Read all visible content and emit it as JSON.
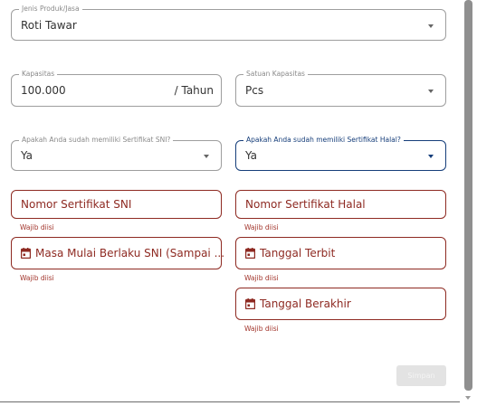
{
  "form": {
    "jenis": {
      "legend": "Jenis Produk/Jasa",
      "value": "Roti Tawar"
    },
    "kapasitas": {
      "legend": "Kapasitas",
      "value": "100.000",
      "suffix": "/ Tahun"
    },
    "satuan": {
      "legend": "Satuan Kapasitas",
      "value": "Pcs"
    },
    "sni_question": {
      "legend": "Apakah Anda sudah memiliki Sertifikat SNI?",
      "value": "Ya"
    },
    "halal_question": {
      "legend": "Apakah Anda sudah memiliki Sertifikat Halal?",
      "value": "Ya"
    },
    "nomor_sni": {
      "placeholder": "Nomor Sertifikat SNI",
      "helper": "Wajib diisi"
    },
    "nomor_halal": {
      "placeholder": "Nomor Sertifikat Halal",
      "helper": "Wajib diisi"
    },
    "masa_sni": {
      "placeholder": "Masa Mulai Berlaku SNI (Sampai ...",
      "helper": "Wajib diisi",
      "icon": "calendar-icon"
    },
    "tanggal_terbit": {
      "placeholder": "Tanggal Terbit",
      "helper": "Wajib diisi",
      "icon": "calendar-icon"
    },
    "tanggal_berakhir": {
      "placeholder": "Tanggal Berakhir",
      "helper": "Wajib diisi",
      "icon": "calendar-icon"
    }
  },
  "submit": {
    "label": "Simpan"
  },
  "colors": {
    "error": "#8e2a22",
    "focus": "#163e7a"
  }
}
